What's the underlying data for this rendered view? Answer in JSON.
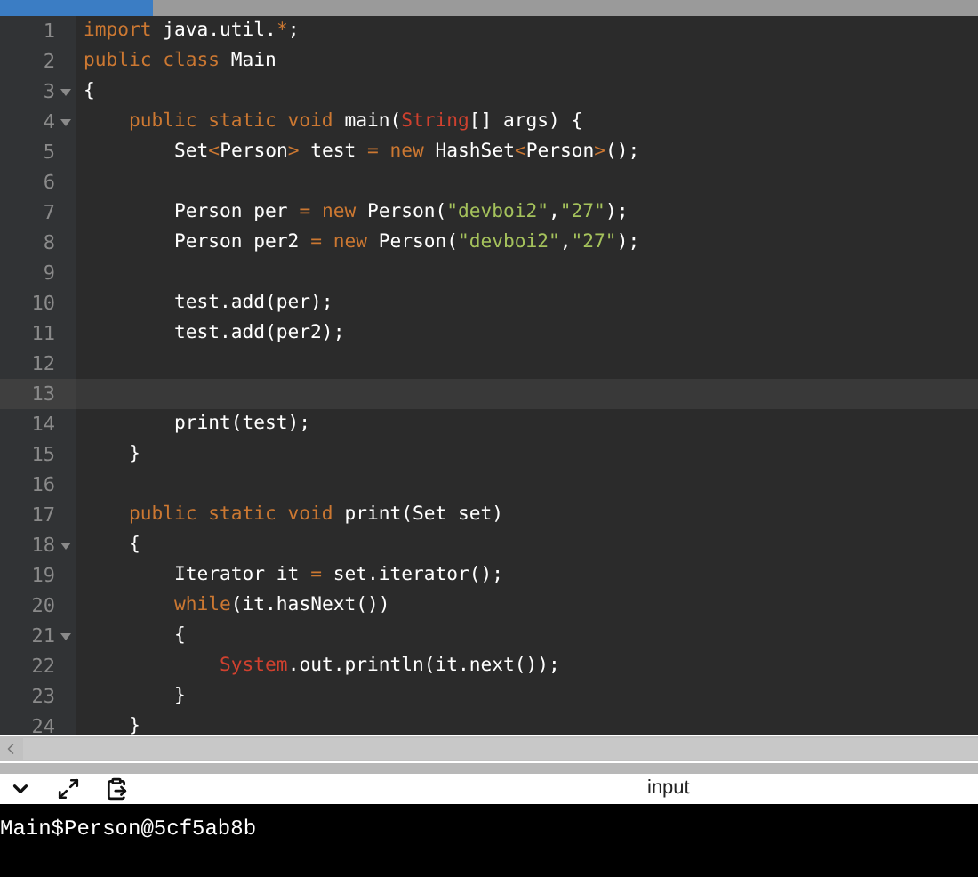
{
  "editor": {
    "lines": [
      {
        "number": "1",
        "foldable": false,
        "current": false,
        "tokens": [
          {
            "text": "import",
            "kind": "keyword"
          },
          {
            "text": " java.util.",
            "kind": "plain"
          },
          {
            "text": "*",
            "kind": "operator"
          },
          {
            "text": ";",
            "kind": "plain"
          }
        ]
      },
      {
        "number": "2",
        "foldable": false,
        "current": false,
        "tokens": [
          {
            "text": "public class",
            "kind": "keyword"
          },
          {
            "text": " Main",
            "kind": "plain"
          }
        ]
      },
      {
        "number": "3",
        "foldable": true,
        "current": false,
        "tokens": [
          {
            "text": "{",
            "kind": "plain"
          }
        ]
      },
      {
        "number": "4",
        "foldable": true,
        "current": false,
        "tokens": [
          {
            "text": "    public static void",
            "kind": "keyword"
          },
          {
            "text": " main(",
            "kind": "plain"
          },
          {
            "text": "String",
            "kind": "class"
          },
          {
            "text": "[] args) {",
            "kind": "plain"
          }
        ]
      },
      {
        "number": "5",
        "foldable": false,
        "current": false,
        "tokens": [
          {
            "text": "        Set",
            "kind": "plain"
          },
          {
            "text": "<",
            "kind": "operator"
          },
          {
            "text": "Person",
            "kind": "plain"
          },
          {
            "text": ">",
            "kind": "operator"
          },
          {
            "text": " test ",
            "kind": "plain"
          },
          {
            "text": "=",
            "kind": "operator"
          },
          {
            "text": " new",
            "kind": "keyword"
          },
          {
            "text": " HashSet",
            "kind": "plain"
          },
          {
            "text": "<",
            "kind": "operator"
          },
          {
            "text": "Person",
            "kind": "plain"
          },
          {
            "text": ">",
            "kind": "operator"
          },
          {
            "text": "();",
            "kind": "plain"
          }
        ]
      },
      {
        "number": "6",
        "foldable": false,
        "current": false
      },
      {
        "number": "7",
        "foldable": false,
        "current": false,
        "tokens": [
          {
            "text": "        Person per ",
            "kind": "plain"
          },
          {
            "text": "=",
            "kind": "operator"
          },
          {
            "text": " new",
            "kind": "keyword"
          },
          {
            "text": " Person(",
            "kind": "plain"
          },
          {
            "text": "\"devboi2\"",
            "kind": "string"
          },
          {
            "text": ",",
            "kind": "plain"
          },
          {
            "text": "\"27\"",
            "kind": "string"
          },
          {
            "text": ");",
            "kind": "plain"
          }
        ]
      },
      {
        "number": "8",
        "foldable": false,
        "current": false,
        "tokens": [
          {
            "text": "        Person per2 ",
            "kind": "plain"
          },
          {
            "text": "=",
            "kind": "operator"
          },
          {
            "text": " new",
            "kind": "keyword"
          },
          {
            "text": " Person(",
            "kind": "plain"
          },
          {
            "text": "\"devboi2\"",
            "kind": "string"
          },
          {
            "text": ",",
            "kind": "plain"
          },
          {
            "text": "\"27\"",
            "kind": "string"
          },
          {
            "text": ");",
            "kind": "plain"
          }
        ]
      },
      {
        "number": "9",
        "foldable": false,
        "current": false
      },
      {
        "number": "10",
        "foldable": false,
        "current": false,
        "tokens": [
          {
            "text": "        test.add(per);",
            "kind": "plain"
          }
        ]
      },
      {
        "number": "11",
        "foldable": false,
        "current": false,
        "tokens": [
          {
            "text": "        test.add(per2);",
            "kind": "plain"
          }
        ]
      },
      {
        "number": "12",
        "foldable": false,
        "current": false
      },
      {
        "number": "13",
        "foldable": false,
        "current": true
      },
      {
        "number": "14",
        "foldable": false,
        "current": false,
        "tokens": [
          {
            "text": "        print(test);",
            "kind": "plain"
          }
        ]
      },
      {
        "number": "15",
        "foldable": false,
        "current": false,
        "tokens": [
          {
            "text": "    }",
            "kind": "plain"
          }
        ]
      },
      {
        "number": "16",
        "foldable": false,
        "current": false
      },
      {
        "number": "17",
        "foldable": false,
        "current": false,
        "tokens": [
          {
            "text": "    public static void",
            "kind": "keyword"
          },
          {
            "text": " print(Set set)",
            "kind": "plain"
          }
        ]
      },
      {
        "number": "18",
        "foldable": true,
        "current": false,
        "tokens": [
          {
            "text": "    {",
            "kind": "plain"
          }
        ]
      },
      {
        "number": "19",
        "foldable": false,
        "current": false,
        "tokens": [
          {
            "text": "        Iterator it ",
            "kind": "plain"
          },
          {
            "text": "=",
            "kind": "operator"
          },
          {
            "text": " set.iterator();",
            "kind": "plain"
          }
        ]
      },
      {
        "number": "20",
        "foldable": false,
        "current": false,
        "tokens": [
          {
            "text": "        while",
            "kind": "keyword"
          },
          {
            "text": "(it.hasNext())",
            "kind": "plain"
          }
        ]
      },
      {
        "number": "21",
        "foldable": true,
        "current": false,
        "tokens": [
          {
            "text": "        {",
            "kind": "plain"
          }
        ]
      },
      {
        "number": "22",
        "foldable": false,
        "current": false,
        "tokens": [
          {
            "text": "            System",
            "kind": "class"
          },
          {
            "text": ".out.println(it.next());",
            "kind": "plain"
          }
        ]
      },
      {
        "number": "23",
        "foldable": false,
        "current": false,
        "tokens": [
          {
            "text": "        }",
            "kind": "plain"
          }
        ]
      },
      {
        "number": "24",
        "foldable": false,
        "current": false,
        "tokens": [
          {
            "text": "    }",
            "kind": "plain"
          }
        ]
      }
    ]
  },
  "console": {
    "input_label": "input",
    "output": "Main$Person@5cf5ab8b"
  }
}
